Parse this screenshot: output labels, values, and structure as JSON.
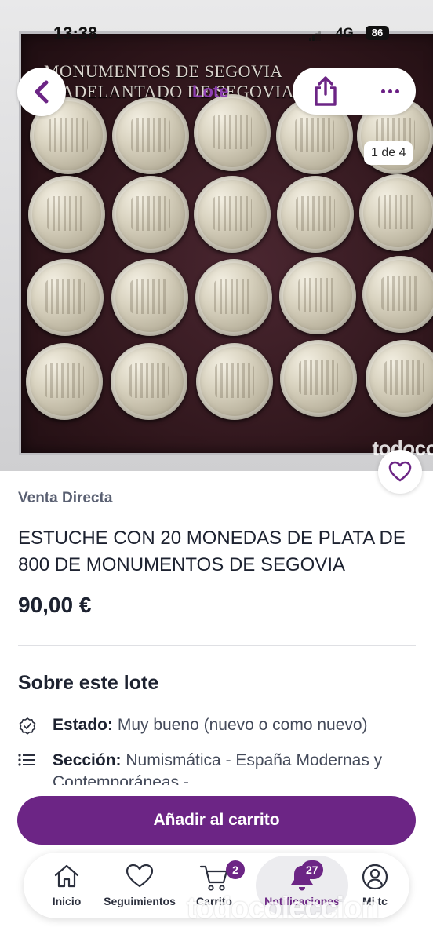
{
  "status_bar": {
    "time": "13:38",
    "network": "4G",
    "battery": "86"
  },
  "header": {
    "lote_label": "Lote",
    "image_counter": "1 de 4"
  },
  "photo": {
    "case_title_line1": "MONUMENTOS DE SEGOVIA",
    "case_title_line2": "EL ADELANTADO DE SEGOVIA",
    "watermark": "todoco"
  },
  "product": {
    "sale_type": "Venta Directa",
    "title": "ESTUCHE CON 20 MONEDAS DE PLATA DE 800 DE MONUMENTOS DE SEGOVIA",
    "price": "90,00 €"
  },
  "about": {
    "heading": "Sobre este lote",
    "state_label": "Estado:",
    "state_value": "Muy bueno (nuevo o como nuevo)",
    "section_label": "Sección:",
    "section_value": "Numismática - España Modernas y Contemporáneas -"
  },
  "cta": {
    "label": "Añadir al carrito"
  },
  "bottom_nav": {
    "items": [
      {
        "label": "Inicio",
        "icon": "home-icon"
      },
      {
        "label": "Seguimientos",
        "icon": "heart-icon"
      },
      {
        "label": "Carrito",
        "icon": "cart-icon",
        "badge": "2"
      },
      {
        "label": "Notificaciones",
        "icon": "bell-icon",
        "badge": "27"
      },
      {
        "label": "Mi tc",
        "icon": "user-icon"
      }
    ],
    "watermark": "todocoleccion"
  },
  "colors": {
    "brand": "#6c2585",
    "text": "#1d2230",
    "muted": "#5a6072"
  }
}
